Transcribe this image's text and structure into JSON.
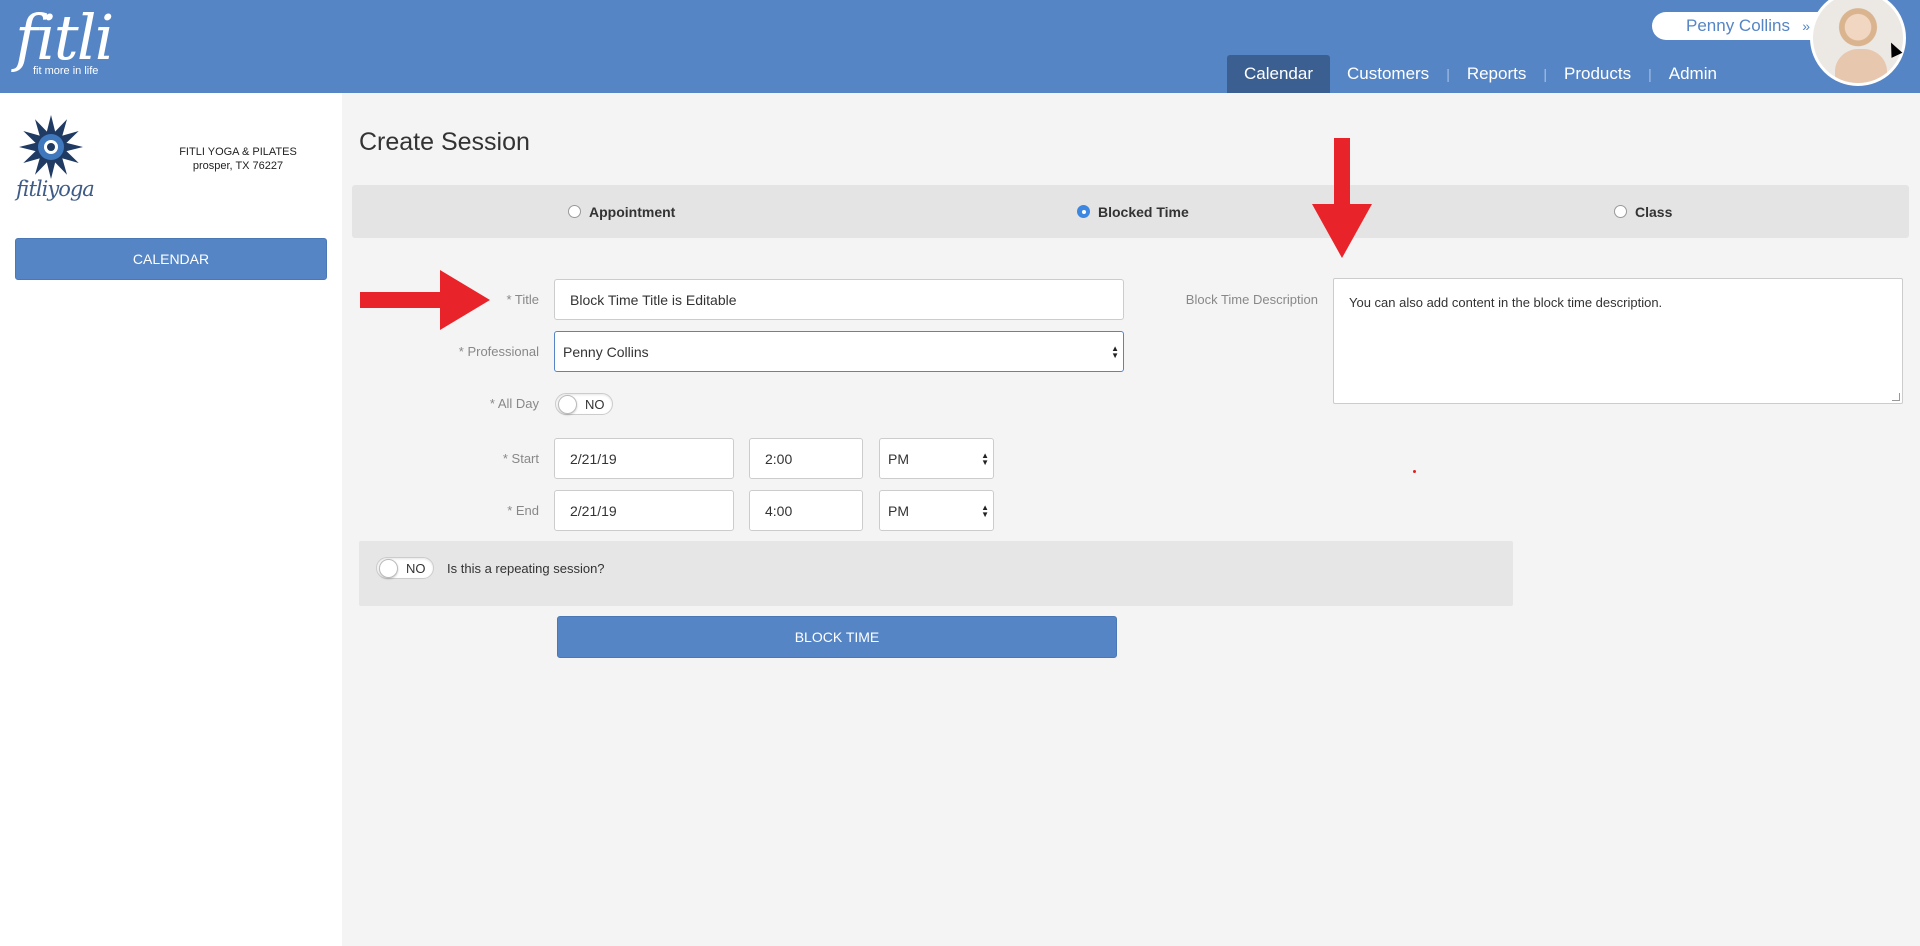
{
  "header": {
    "brand": "fitli",
    "tagline": "fit more in life",
    "user_name": "Penny Collins",
    "user_menu_icon": "chevron-double-down-icon",
    "nav": [
      {
        "label": "Calendar",
        "active": true
      },
      {
        "label": "Customers",
        "active": false
      },
      {
        "label": "Reports",
        "active": false
      },
      {
        "label": "Products",
        "active": false
      },
      {
        "label": "Admin",
        "active": false
      }
    ],
    "nav_separator": "|"
  },
  "sidebar": {
    "logo_text": "fitliyoga",
    "studio_name": "FITLI YOGA & PILATES",
    "studio_location": "prosper, TX 76227",
    "calendar_button": "CALENDAR"
  },
  "main": {
    "page_title": "Create Session",
    "session_types": [
      {
        "label": "Appointment",
        "selected": false
      },
      {
        "label": "Blocked Time",
        "selected": true
      },
      {
        "label": "Class",
        "selected": false
      }
    ],
    "form": {
      "title_label": "* Title",
      "title_value": "Block Time Title is Editable",
      "professional_label": "* Professional",
      "professional_value": "Penny Collins",
      "allday_label": "* All Day",
      "allday_value": "NO",
      "start_label": "* Start",
      "start_date": "2/21/19",
      "start_time": "2:00",
      "start_ampm": "PM",
      "end_label": "* End",
      "end_date": "2/21/19",
      "end_time": "4:00",
      "end_ampm": "PM",
      "description_label": "Block Time Description",
      "description_value": "You can also add content in the block time description."
    },
    "repeat": {
      "toggle_value": "NO",
      "question": "Is this a repeating session?"
    },
    "submit_button": "BLOCK TIME"
  },
  "colors": {
    "header_bg": "#5585c5",
    "nav_active_bg": "#3b5f91",
    "button_bg": "#5585c5",
    "radio_selected": "#3d87e0",
    "annotation_arrow": "#e8242a"
  }
}
